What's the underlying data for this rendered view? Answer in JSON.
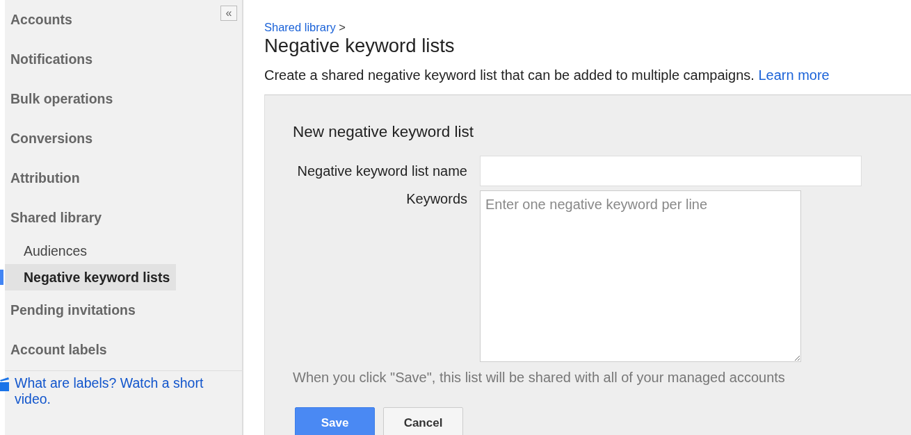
{
  "sidebar": {
    "collapse_button": "«",
    "items": [
      {
        "label": "Accounts",
        "kind": "section",
        "selected": false
      },
      {
        "label": "Notifications",
        "kind": "section",
        "selected": false
      },
      {
        "label": "Bulk operations",
        "kind": "section",
        "selected": false
      },
      {
        "label": "Conversions",
        "kind": "section",
        "selected": false
      },
      {
        "label": "Attribution",
        "kind": "section",
        "selected": false
      },
      {
        "label": "Shared library",
        "kind": "section",
        "selected": false
      },
      {
        "label": "Audiences",
        "kind": "sub",
        "selected": false
      },
      {
        "label": "Negative keyword lists",
        "kind": "sub",
        "selected": true
      },
      {
        "label": "Pending invitations",
        "kind": "section",
        "selected": false
      },
      {
        "label": "Account labels",
        "kind": "section",
        "selected": false
      }
    ],
    "help_link": "What are labels? Watch a short video."
  },
  "breadcrumb": {
    "link": "Shared library",
    "separator": ">"
  },
  "title": "Negative keyword lists",
  "description": {
    "text": "Create a shared negative keyword list that can be added to multiple campaigns.",
    "link": "Learn more"
  },
  "form": {
    "heading": "New negative keyword list",
    "fields": [
      {
        "label": "Negative keyword list name",
        "kind": "input"
      },
      {
        "label": "Keywords",
        "kind": "textarea",
        "placeholder": "Enter one negative keyword per line"
      }
    ],
    "note": "When you click \"Save\", this list will be shared with all of your managed accounts",
    "buttons": [
      {
        "label": "Save",
        "kind": "primary"
      },
      {
        "label": "Cancel",
        "kind": "secondary"
      }
    ]
  }
}
